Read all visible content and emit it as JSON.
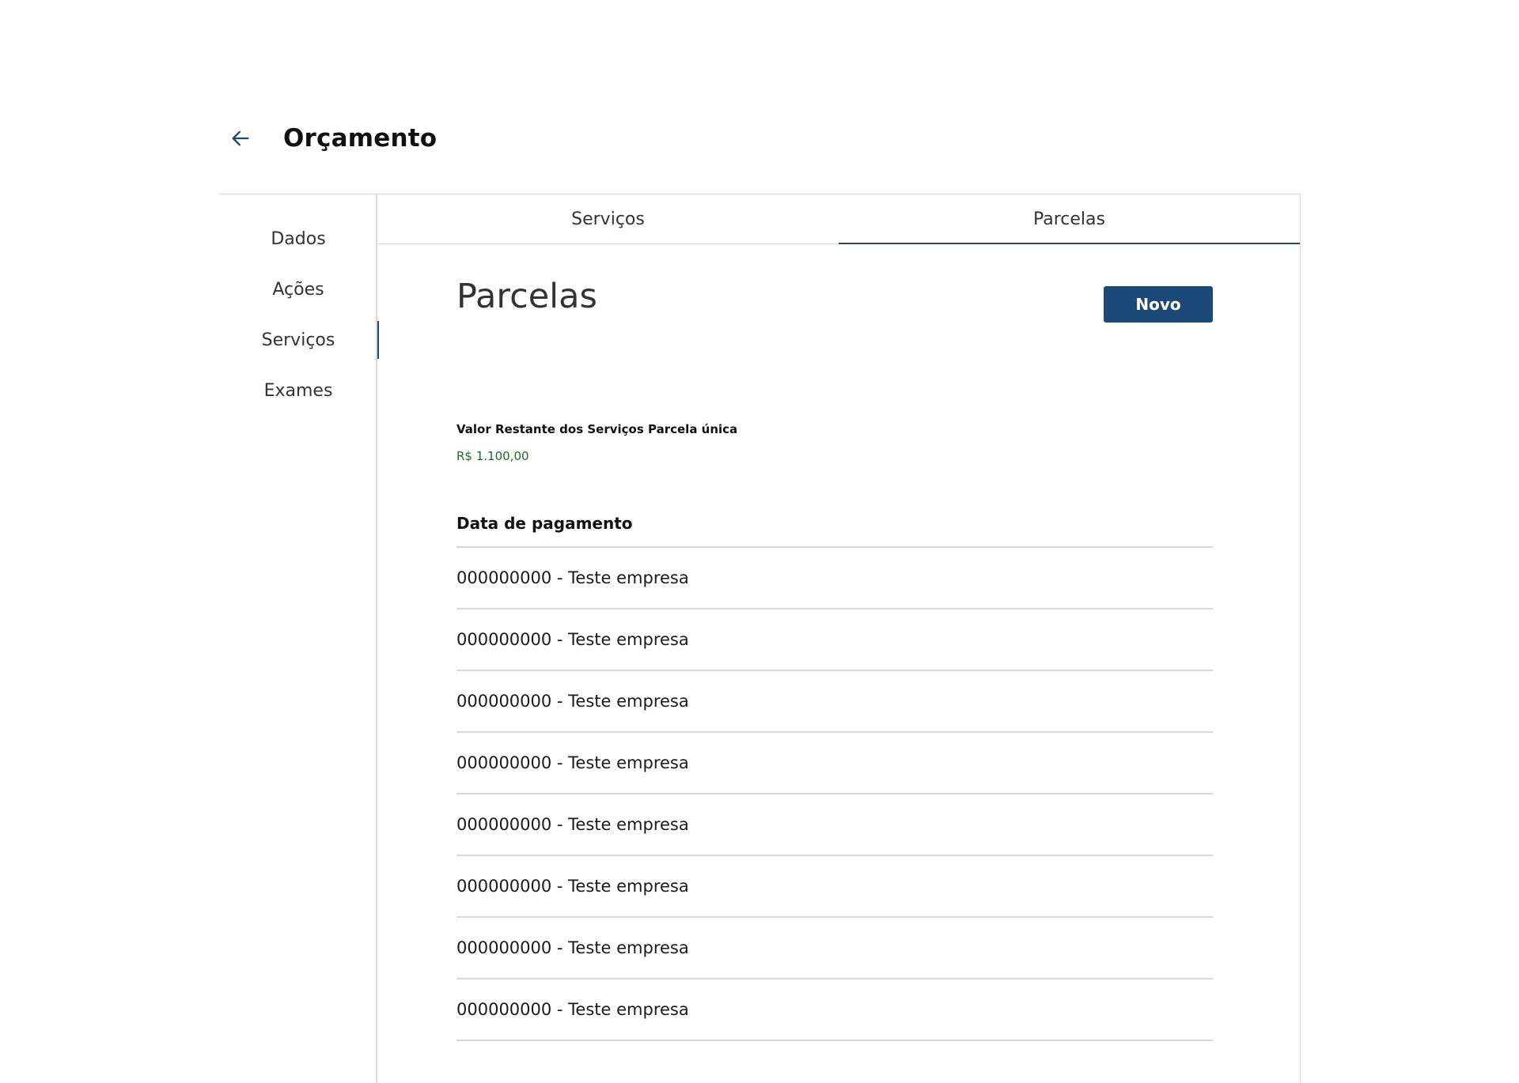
{
  "header": {
    "title": "Orçamento",
    "back_icon": "arrow-left-icon",
    "accent_color": "#1b4a78"
  },
  "sidebar": {
    "items": [
      {
        "label": "Dados",
        "active": false
      },
      {
        "label": "Ações",
        "active": false
      },
      {
        "label": "Serviços",
        "active": true
      },
      {
        "label": "Exames",
        "active": false
      }
    ]
  },
  "tabs": [
    {
      "label": "Serviços",
      "active": false
    },
    {
      "label": "Parcelas",
      "active": true
    }
  ],
  "main": {
    "section_title": "Parcelas",
    "new_button_label": "Novo",
    "remaining_label": "Valor Restante dos Serviços Parcela única",
    "remaining_value": "R$ 1.100,00",
    "remaining_value_color": "#1f6b2e",
    "list_header": "Data de pagamento",
    "items": [
      "000000000 - Teste empresa",
      "000000000 - Teste empresa",
      "000000000 - Teste empresa",
      "000000000 - Teste empresa",
      "000000000 - Teste empresa",
      "000000000 - Teste empresa",
      "000000000 - Teste empresa",
      "000000000 - Teste empresa"
    ]
  }
}
